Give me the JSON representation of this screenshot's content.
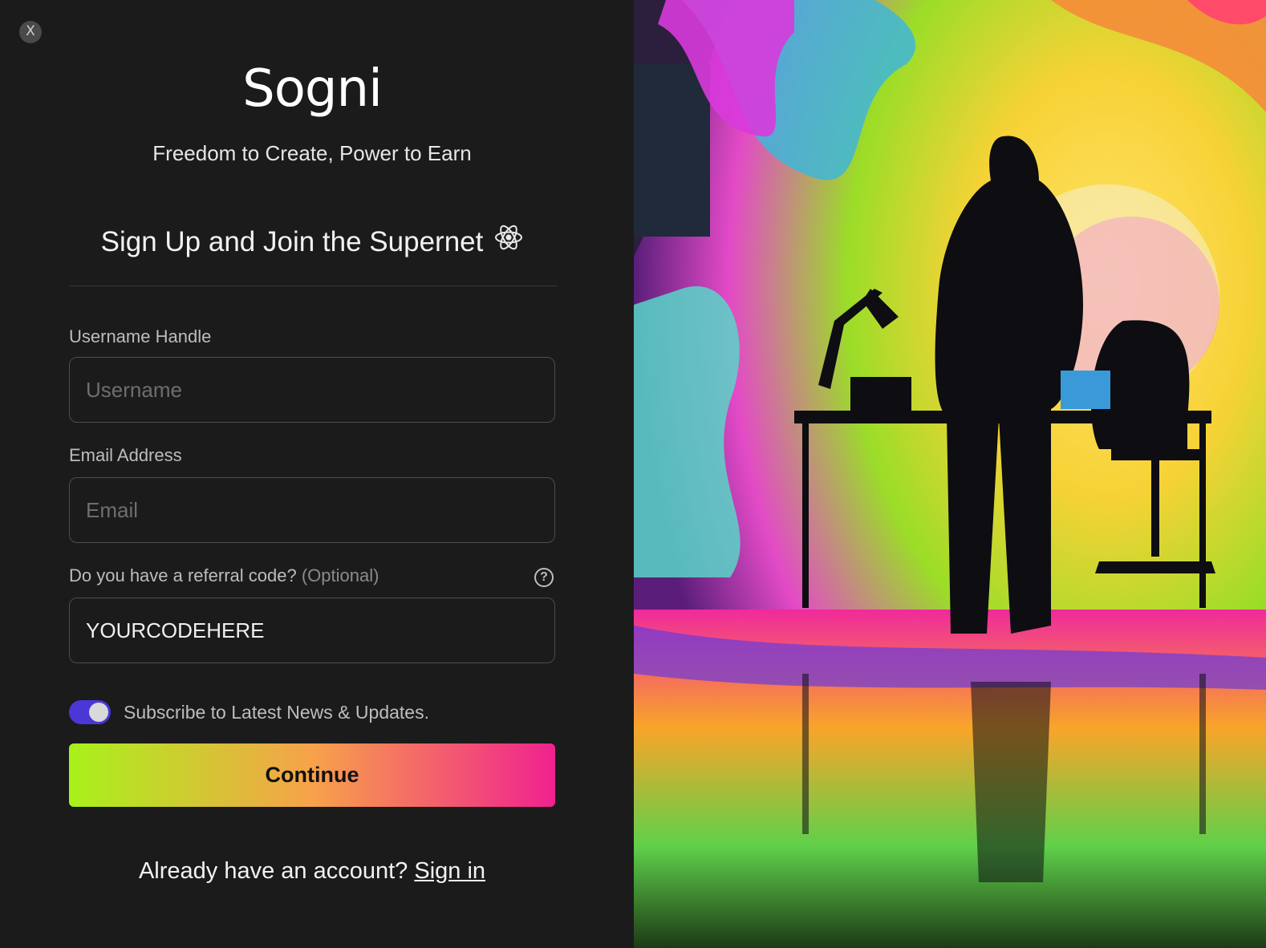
{
  "close_label": "X",
  "brand": {
    "name": "Sogni",
    "tagline": "Freedom to Create, Power to Earn"
  },
  "heading": {
    "title": "Sign Up and Join the Supernet",
    "icon": "atom-icon"
  },
  "form": {
    "username": {
      "label": "Username Handle",
      "placeholder": "Username",
      "value": ""
    },
    "email": {
      "label": "Email Address",
      "placeholder": "Email",
      "value": ""
    },
    "referral": {
      "label": "Do you have a referral code?",
      "optional": "(Optional)",
      "value": "YOURCODEHERE",
      "help_icon": "question-circle-icon",
      "help_glyph": "?"
    },
    "subscribe": {
      "label": "Subscribe to Latest News & Updates.",
      "checked": true
    },
    "submit_label": "Continue"
  },
  "footer": {
    "prompt": "Already have an account?",
    "link": "Sign in"
  },
  "colors": {
    "bg": "#1b1b1b",
    "toggle_on": "#4a37d6",
    "gradient": [
      "#a8f21a",
      "#f7a24a",
      "#f0218f"
    ]
  }
}
